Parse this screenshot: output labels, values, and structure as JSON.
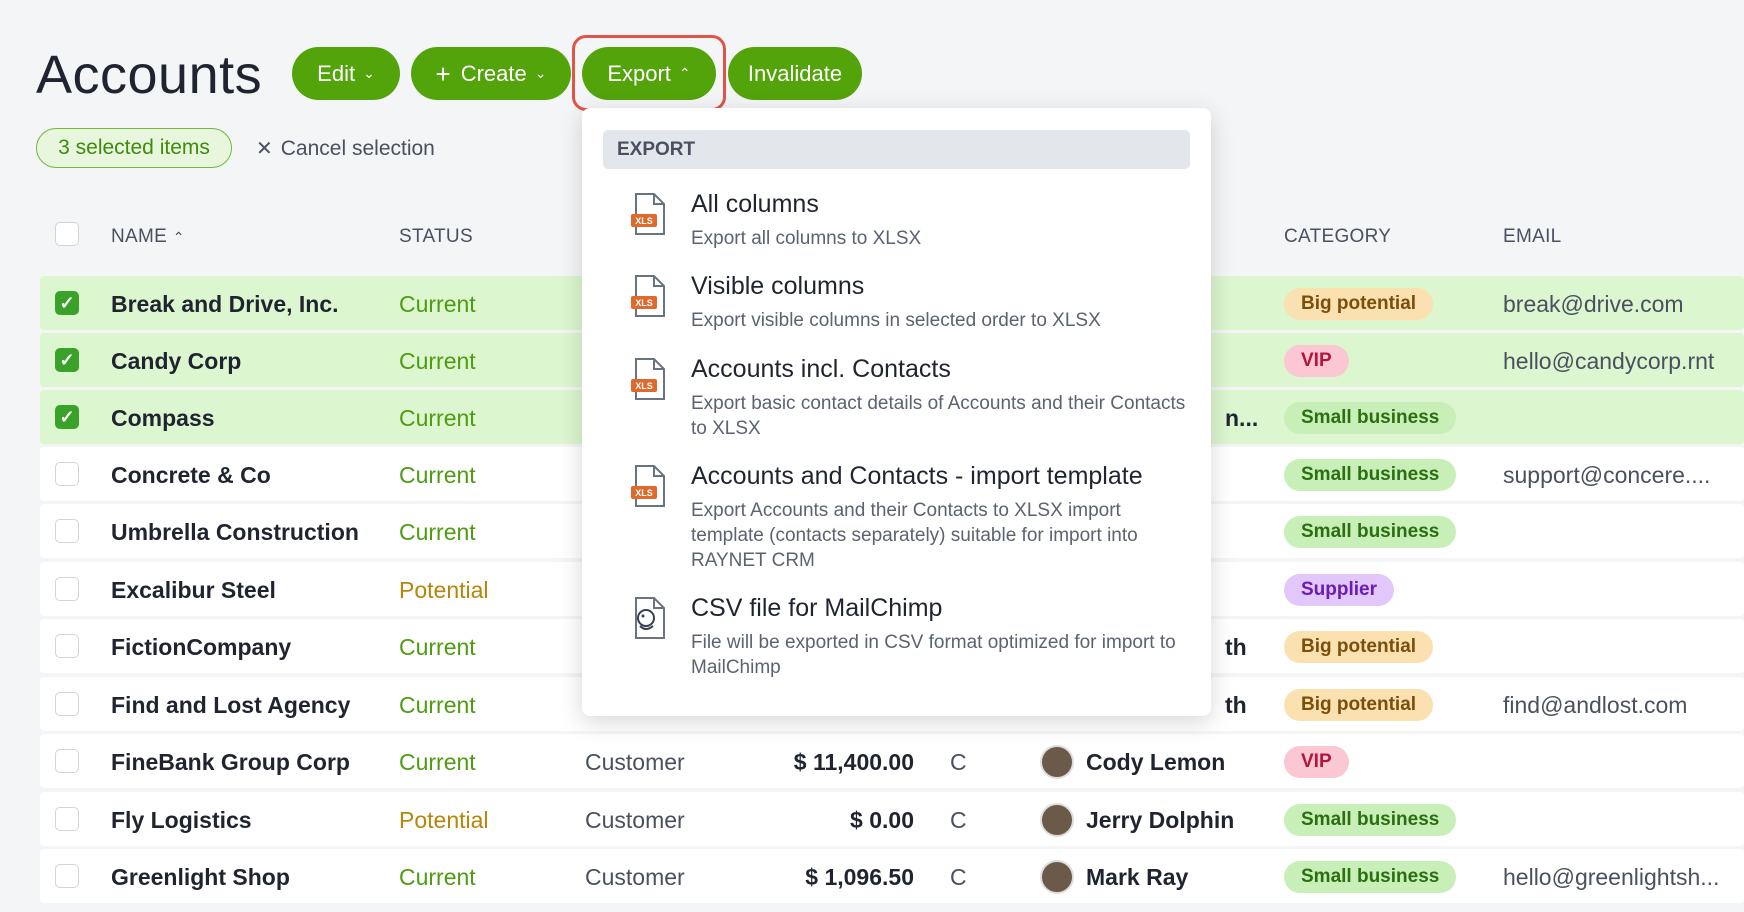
{
  "page": {
    "title": "Accounts"
  },
  "toolbar": {
    "edit_label": "Edit",
    "create_label": "Create",
    "export_label": "Export",
    "invalidate_label": "Invalidate"
  },
  "selection": {
    "pill_text": "3 selected items",
    "cancel_label": "Cancel selection"
  },
  "table": {
    "columns": {
      "name": "NAME",
      "status": "STATUS",
      "category": "CATEGORY",
      "email": "EMAIL"
    },
    "rows": [
      {
        "name": "Break and Drive, Inc.",
        "status": "Current",
        "status_kind": "current",
        "type": "",
        "value": "",
        "rating": "",
        "owner": "",
        "owner_frag": "",
        "category": "Big potential",
        "category_kind": "big",
        "email": "break@drive.com",
        "selected": true
      },
      {
        "name": "Candy Corp",
        "status": "Current",
        "status_kind": "current",
        "type": "",
        "value": "",
        "rating": "",
        "owner": "",
        "owner_frag": "",
        "category": "VIP",
        "category_kind": "vip",
        "email": "hello@candycorp.rnt",
        "selected": true
      },
      {
        "name": "Compass",
        "status": "Current",
        "status_kind": "current",
        "type": "",
        "value": "",
        "rating": "",
        "owner": "",
        "owner_frag": "n...",
        "category": "Small business",
        "category_kind": "small",
        "email": "",
        "selected": true
      },
      {
        "name": "Concrete & Co",
        "status": "Current",
        "status_kind": "current",
        "type": "",
        "value": "",
        "rating": "",
        "owner": "",
        "owner_frag": "",
        "category": "Small business",
        "category_kind": "small",
        "email": "support@concere....",
        "selected": false
      },
      {
        "name": "Umbrella Construction",
        "status": "Current",
        "status_kind": "current",
        "type": "",
        "value": "",
        "rating": "",
        "owner": "",
        "owner_frag": "",
        "category": "Small business",
        "category_kind": "small",
        "email": "",
        "selected": false
      },
      {
        "name": "Excalibur Steel",
        "status": "Potential",
        "status_kind": "potential",
        "type": "",
        "value": "",
        "rating": "",
        "owner": "",
        "owner_frag": "",
        "category": "Supplier",
        "category_kind": "supplier",
        "email": "",
        "selected": false
      },
      {
        "name": "FictionCompany",
        "status": "Current",
        "status_kind": "current",
        "type": "",
        "value": "",
        "rating": "",
        "owner": "",
        "owner_frag": "th",
        "category": "Big potential",
        "category_kind": "big",
        "email": "",
        "selected": false
      },
      {
        "name": "Find and Lost Agency",
        "status": "Current",
        "status_kind": "current",
        "type": "",
        "value": "",
        "rating": "",
        "owner": "",
        "owner_frag": "th",
        "category": "Big potential",
        "category_kind": "big",
        "email": "find@andlost.com",
        "selected": false
      },
      {
        "name": "FineBank Group Corp",
        "status": "Current",
        "status_kind": "current",
        "type": "Customer",
        "value": "$ 11,400.00",
        "rating": "C",
        "owner": "Cody Lemon",
        "owner_frag": "",
        "category": "VIP",
        "category_kind": "vip",
        "email": "",
        "selected": false
      },
      {
        "name": "Fly Logistics",
        "status": "Potential",
        "status_kind": "potential",
        "type": "Customer",
        "value": "$ 0.00",
        "rating": "C",
        "owner": "Jerry Dolphin",
        "owner_frag": "",
        "category": "Small business",
        "category_kind": "small",
        "email": "",
        "selected": false
      },
      {
        "name": "Greenlight Shop",
        "status": "Current",
        "status_kind": "current",
        "type": "Customer",
        "value": "$ 1,096.50",
        "rating": "C",
        "owner": "Mark Ray",
        "owner_frag": "",
        "category": "Small business",
        "category_kind": "small",
        "email": "hello@greenlightsh...",
        "selected": false
      }
    ]
  },
  "export_menu": {
    "header": "EXPORT",
    "items": [
      {
        "title": "All columns",
        "desc": "Export all columns to XLSX",
        "icon": "xls-file-icon"
      },
      {
        "title": "Visible columns",
        "desc": "Export visible columns in selected order to XLSX",
        "icon": "xls-file-icon"
      },
      {
        "title": "Accounts incl. Contacts",
        "desc": "Export basic contact details of Accounts and their Contacts to XLSX",
        "icon": "xls-file-icon"
      },
      {
        "title": "Accounts and Contacts - import template",
        "desc": "Export Accounts and their Contacts to XLSX import template (contacts separately) suitable for import into RAYNET CRM",
        "icon": "xls-file-icon"
      },
      {
        "title": "CSV file for MailChimp",
        "desc": "File will be exported in CSV format optimized for import to MailChimp",
        "icon": "mailchimp-file-icon"
      }
    ],
    "xls_badge": "XLS"
  },
  "colors": {
    "accent_green": "#53a30b",
    "highlight_red": "#e0554a",
    "selected_row": "#dcf6cf"
  }
}
